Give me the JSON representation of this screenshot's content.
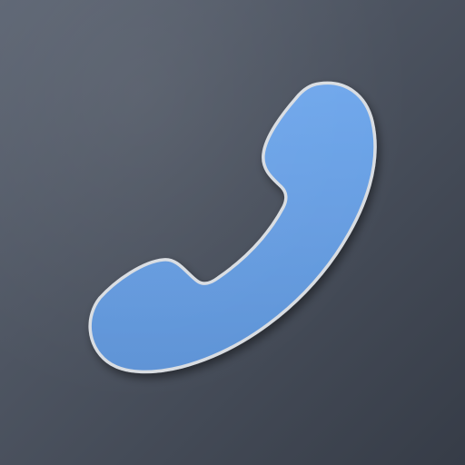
{
  "icon": {
    "name": "phone-handset-icon",
    "colors": {
      "background_top": "#5d6573",
      "background_bottom": "#363c47",
      "handset_fill_top": "#6fa7ec",
      "handset_fill_bottom": "#5e93d6",
      "handset_outline": "#d9dde2"
    }
  }
}
